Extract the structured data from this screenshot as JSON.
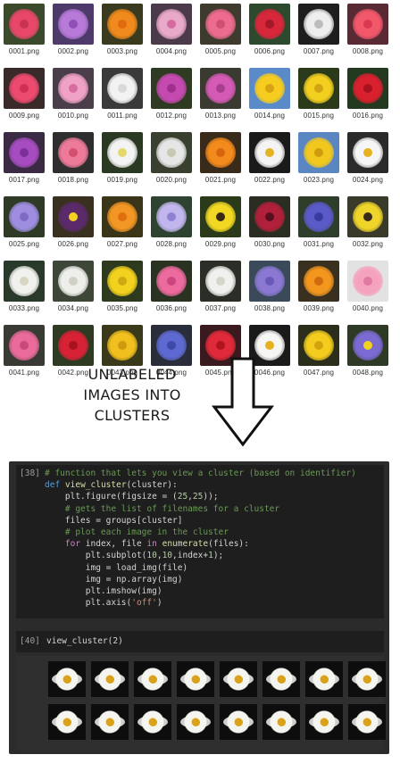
{
  "files": [
    {
      "name": "0001.png",
      "bg": "#3a4a2a",
      "petal": "#e8476a",
      "core": "#c9334f"
    },
    {
      "name": "0002.png",
      "bg": "#4e3a6a",
      "petal": "#b77ad8",
      "core": "#8f4fb5"
    },
    {
      "name": "0003.png",
      "bg": "#3a3a1e",
      "petal": "#f08a1c",
      "core": "#e06a10"
    },
    {
      "name": "0004.png",
      "bg": "#4a3a4a",
      "petal": "#e9a9c8",
      "core": "#d46aa0"
    },
    {
      "name": "0005.png",
      "bg": "#3e3a2e",
      "petal": "#ec6b8e",
      "core": "#cf4e74"
    },
    {
      "name": "0006.png",
      "bg": "#2e4a2e",
      "petal": "#d8263a",
      "core": "#a4182a"
    },
    {
      "name": "0007.png",
      "bg": "#1e1e1e",
      "petal": "#eeeeee",
      "core": "#bcbcbc"
    },
    {
      "name": "0008.png",
      "bg": "#5a2a34",
      "petal": "#f2586a",
      "core": "#d93a52"
    },
    {
      "name": "0009.png",
      "bg": "#3a2a2a",
      "petal": "#ec4a6e",
      "core": "#d12f55"
    },
    {
      "name": "0010.png",
      "bg": "#4a3e4a",
      "petal": "#efa1c6",
      "core": "#d86ea0"
    },
    {
      "name": "0011.png",
      "bg": "#3a3a3a",
      "petal": "#f2f2f2",
      "core": "#d9d9d9"
    },
    {
      "name": "0012.png",
      "bg": "#2e3a22",
      "petal": "#c54ab0",
      "core": "#9f2f8e"
    },
    {
      "name": "0013.png",
      "bg": "#3a3a30",
      "petal": "#d55ab6",
      "core": "#a83e8e"
    },
    {
      "name": "0014.png",
      "bg": "#5a8ac8",
      "petal": "#f6cc1e",
      "core": "#d9a411"
    },
    {
      "name": "0015.png",
      "bg": "#2a3a1a",
      "petal": "#f3cf20",
      "core": "#d2a410"
    },
    {
      "name": "0016.png",
      "bg": "#243a20",
      "petal": "#d9202e",
      "core": "#a8121e"
    },
    {
      "name": "0017.png",
      "bg": "#3a2a44",
      "petal": "#a64cc0",
      "core": "#7d2f98"
    },
    {
      "name": "0018.png",
      "bg": "#2e2e2e",
      "petal": "#ee7a9a",
      "core": "#d2506e"
    },
    {
      "name": "0019.png",
      "bg": "#2a3a22",
      "petal": "#f3f3f3",
      "core": "#e5d86a"
    },
    {
      "name": "0020.png",
      "bg": "#3a4030",
      "petal": "#e6e6e6",
      "core": "#c8c8b0"
    },
    {
      "name": "0021.png",
      "bg": "#3a2a1a",
      "petal": "#f28a1c",
      "core": "#d8650e"
    },
    {
      "name": "0022.png",
      "bg": "#1a1a1a",
      "petal": "#f4f4f4",
      "core": "#e3b321"
    },
    {
      "name": "0023.png",
      "bg": "#5a86c2",
      "petal": "#f2c81e",
      "core": "#d09c0e"
    },
    {
      "name": "0024.png",
      "bg": "#2a2a2a",
      "petal": "#f6f6f6",
      "core": "#e6b31e"
    },
    {
      "name": "0025.png",
      "bg": "#2e3a26",
      "petal": "#9f8ee0",
      "core": "#7d6bc6"
    },
    {
      "name": "0026.png",
      "bg": "#3a3020",
      "petal": "#5a2a6a",
      "core": "#f2d21e"
    },
    {
      "name": "0027.png",
      "bg": "#3a3418",
      "petal": "#f29624",
      "core": "#e0700e"
    },
    {
      "name": "0028.png",
      "bg": "#2e4430",
      "petal": "#c2b6ee",
      "core": "#8f80d2"
    },
    {
      "name": "0029.png",
      "bg": "#2a3a1a",
      "petal": "#f2d822",
      "core": "#3a2a14"
    },
    {
      "name": "0030.png",
      "bg": "#2a2e22",
      "petal": "#b0203a",
      "core": "#5a0f1e"
    },
    {
      "name": "0031.png",
      "bg": "#2e3e2a",
      "petal": "#5a5ac8",
      "core": "#3a3aa0"
    },
    {
      "name": "0032.png",
      "bg": "#3a3a2a",
      "petal": "#efd42a",
      "core": "#3a2a1a"
    },
    {
      "name": "0033.png",
      "bg": "#2a3a2a",
      "petal": "#f1f1ee",
      "core": "#d6d6c2"
    },
    {
      "name": "0034.png",
      "bg": "#3e4638",
      "petal": "#eeeeea",
      "core": "#d0d0c4"
    },
    {
      "name": "0035.png",
      "bg": "#2e3a1e",
      "petal": "#f2d21e",
      "core": "#cfa812"
    },
    {
      "name": "0036.png",
      "bg": "#2a3222",
      "petal": "#ec6a9e",
      "core": "#cb467e"
    },
    {
      "name": "0037.png",
      "bg": "#2a2e26",
      "petal": "#f0f0ee",
      "core": "#d6d6c8"
    },
    {
      "name": "0038.png",
      "bg": "#3a4a5a",
      "petal": "#8a78d2",
      "core": "#6a58b6"
    },
    {
      "name": "0039.png",
      "bg": "#3a3020",
      "petal": "#f2961e",
      "core": "#d06a0e"
    },
    {
      "name": "0040.png",
      "bg": "#e2e2e2",
      "petal": "#f4a2be",
      "core": "#e07aa0"
    },
    {
      "name": "0041.png",
      "bg": "#3a3a34",
      "petal": "#ea6a9a",
      "core": "#c84a7a"
    },
    {
      "name": "0042.png",
      "bg": "#2e3a22",
      "petal": "#d62234",
      "core": "#a8141e"
    },
    {
      "name": "0043.png",
      "bg": "#3a3a1a",
      "petal": "#f2c01e",
      "core": "#d09a0e"
    },
    {
      "name": "0044.png",
      "bg": "#2a2e3a",
      "petal": "#5e6ad2",
      "core": "#3e4aa8"
    },
    {
      "name": "0045.png",
      "bg": "#3a1a1e",
      "petal": "#e02a3a",
      "core": "#b0141e"
    },
    {
      "name": "0046.png",
      "bg": "#1a1a1a",
      "petal": "#f6f6f4",
      "core": "#e6b01e"
    },
    {
      "name": "0047.png",
      "bg": "#2a2e1a",
      "petal": "#f4cc1e",
      "core": "#d4a40e"
    },
    {
      "name": "0048.png",
      "bg": "#2e3a26",
      "petal": "#7a6ad2",
      "core": "#f2d21e"
    }
  ],
  "caption": {
    "line1": "UNLABELED",
    "line2": "IMAGES INTO",
    "line3": "CLUSTERS"
  },
  "notebook": {
    "cell1_prompt": "[38]",
    "cell1_lines": [
      "# function that lets you view a cluster (based on identifier)",
      "def view_cluster(cluster):",
      "    plt.figure(figsize = (25,25));",
      "    # gets the list of filenames for a cluster",
      "    files = groups[cluster]",
      "    # plot each image in the cluster",
      "    for index, file in enumerate(files):",
      "        plt.subplot(10,10,index+1);",
      "        img = load_img(file)",
      "        img = np.array(img)",
      "        plt.imshow(img)",
      "        plt.axis('off')"
    ],
    "cell2_prompt": "[40]",
    "cell2_code": "view_cluster(2)",
    "output_count": 16
  }
}
